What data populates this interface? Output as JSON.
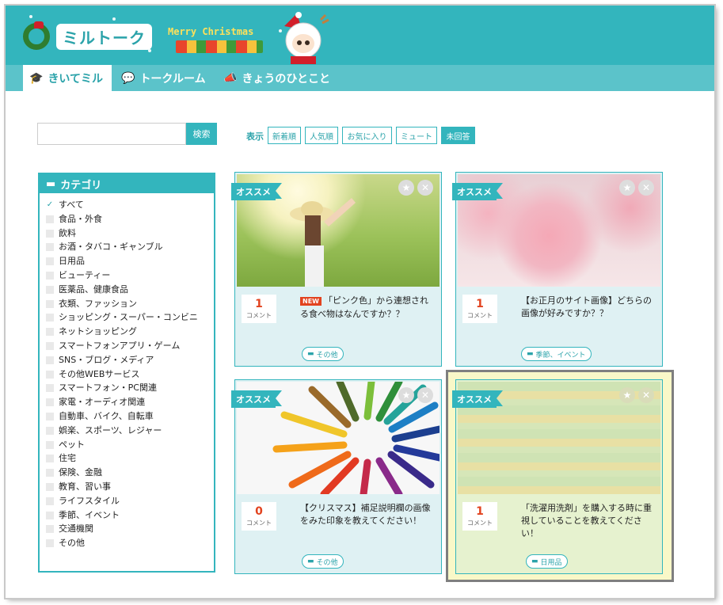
{
  "header": {
    "logo_text": "ミルトーク",
    "banner_text": "Merry Christmas"
  },
  "nav": {
    "tabs": [
      {
        "label": "きいてミル",
        "icon": "graduation-cap-icon",
        "active": true
      },
      {
        "label": "トークルーム",
        "icon": "chat-bubbles-icon",
        "active": false
      },
      {
        "label": "きょうのひとこと",
        "icon": "megaphone-icon",
        "active": false
      }
    ]
  },
  "search": {
    "placeholder": "",
    "button": "検索"
  },
  "filters": {
    "label": "表示",
    "options": [
      "新着順",
      "人気順",
      "お気に入り",
      "ミュート",
      "未回答"
    ],
    "selected": "未回答"
  },
  "categories": {
    "title": "カテゴリ",
    "items": [
      "すべて",
      "食品・外食",
      "飲料",
      "お酒・タバコ・ギャンブル",
      "日用品",
      "ビューティー",
      "医薬品、健康食品",
      "衣類、ファッション",
      "ショッピング・スーパー・コンビニ",
      "ネットショッピング",
      "スマートフォンアプリ・ゲーム",
      "SNS・ブログ・メディア",
      "その他WEBサービス",
      "スマートフォン・PC関連",
      "家電・オーディオ関連",
      "自動車、バイク、自転車",
      "娯楽、スポーツ、レジャー",
      "ペット",
      "住宅",
      "保険、金融",
      "教育、習い事",
      "ライフスタイル",
      "季節、イベント",
      "交通機関",
      "その他"
    ],
    "checked": "すべて"
  },
  "cards": [
    {
      "ribbon": "オススメ",
      "count": "1",
      "count_label": "コメント",
      "new": "NEW",
      "title": "「ピンク色」から連想される食べ物はなんですか？？",
      "tag": "その他"
    },
    {
      "ribbon": "オススメ",
      "count": "1",
      "count_label": "コメント",
      "title": "【お正月のサイト画像】どちらの画像が好みですか？？",
      "tag": "季節、イベント"
    },
    {
      "ribbon": "オススメ",
      "count": "0",
      "count_label": "コメント",
      "title": "【クリスマス】補足説明欄の画像をみた印象を教えてください！",
      "tag": "その他"
    },
    {
      "ribbon": "オススメ",
      "count": "1",
      "count_label": "コメント",
      "title": "「洗濯用洗剤」を購入する時に重視していることを教えてください！",
      "tag": "日用品"
    }
  ],
  "colors": {
    "accent": "#33b5bd",
    "nav": "#5bc3ca",
    "count": "#e2431f",
    "highlight": "#f9f8c8"
  }
}
